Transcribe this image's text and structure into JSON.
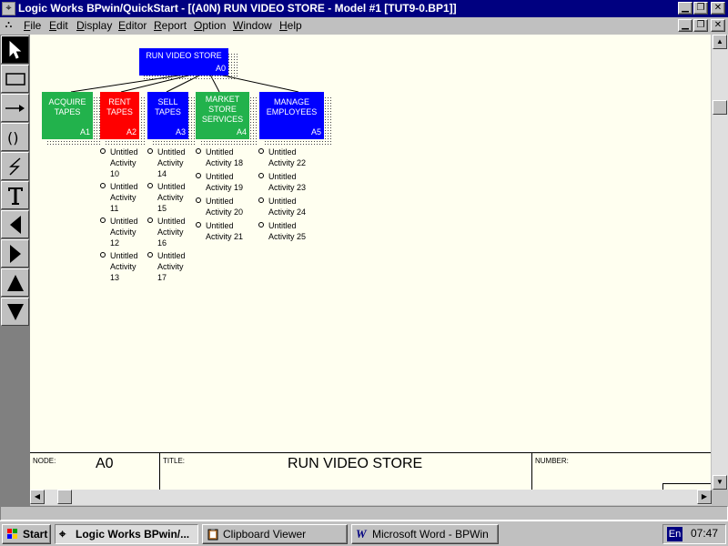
{
  "window": {
    "title": "Logic Works BPwin/QuickStart - [(A0N) RUN VIDEO STORE - Model #1  [TUT9-0.BP1]]",
    "app_icon": "bpwin-icon",
    "controls": [
      "minimize",
      "restore",
      "close"
    ]
  },
  "menu": {
    "items": [
      {
        "label": "File"
      },
      {
        "label": "Edit"
      },
      {
        "label": "Display"
      },
      {
        "label": "Editor"
      },
      {
        "label": "Report"
      },
      {
        "label": "Option"
      },
      {
        "label": "Window"
      },
      {
        "label": "Help"
      }
    ]
  },
  "toolbox": {
    "tools": [
      "pointer-tool",
      "box-tool",
      "arrow-tool",
      "tunnel-tool",
      "squiggle-tool",
      "text-tool",
      "go-left-tool",
      "go-right-tool",
      "go-up-tool",
      "go-down-tool"
    ]
  },
  "diagram": {
    "root": {
      "label": "RUN VIDEO STORE",
      "node": "A0",
      "color": "#0000ff"
    },
    "children": [
      {
        "label_line1": "ACQUIRE",
        "label_line2": "TAPES",
        "label_line3": "",
        "node": "A1",
        "color": "#22b24c"
      },
      {
        "label_line1": "RENT",
        "label_line2": "TAPES",
        "label_line3": "",
        "node": "A2",
        "color": "#ff0000"
      },
      {
        "label_line1": "SELL",
        "label_line2": "TAPES",
        "label_line3": "",
        "node": "A3",
        "color": "#0000ff"
      },
      {
        "label_line1": "MARKET",
        "label_line2": "STORE",
        "label_line3": "SERVICES",
        "node": "A4",
        "color": "#22b24c"
      },
      {
        "label_line1": "MANAGE",
        "label_line2": "EMPLOYEES",
        "label_line3": "",
        "node": "A5",
        "color": "#0000ff"
      }
    ],
    "activity_columns": [
      [
        {
          "line1": "Untitled",
          "line2": "Activity",
          "line3": "10"
        },
        {
          "line1": "Untitled",
          "line2": "Activity",
          "line3": "11"
        },
        {
          "line1": "Untitled",
          "line2": "Activity",
          "line3": "12"
        },
        {
          "line1": "Untitled",
          "line2": "Activity",
          "line3": "13"
        }
      ],
      [
        {
          "line1": "Untitled",
          "line2": "Activity",
          "line3": "14"
        },
        {
          "line1": "Untitled",
          "line2": "Activity",
          "line3": "15"
        },
        {
          "line1": "Untitled",
          "line2": "Activity",
          "line3": "16"
        },
        {
          "line1": "Untitled",
          "line2": "Activity",
          "line3": "17"
        }
      ],
      [
        {
          "line1": "Untitled",
          "line2": "Activity 18"
        },
        {
          "line1": "Untitled",
          "line2": "Activity 19"
        },
        {
          "line1": "Untitled",
          "line2": "Activity 20"
        },
        {
          "line1": "Untitled",
          "line2": "Activity 21"
        }
      ],
      [
        {
          "line1": "Untitled",
          "line2": "Activity 22"
        },
        {
          "line1": "Untitled",
          "line2": "Activity 23"
        },
        {
          "line1": "Untitled",
          "line2": "Activity 24"
        },
        {
          "line1": "Untitled",
          "line2": "Activity 25"
        }
      ]
    ]
  },
  "footer": {
    "node_label": "NODE:",
    "node_value": "A0",
    "title_label": "TITLE:",
    "title_value": "RUN VIDEO STORE",
    "number_label": "NUMBER:"
  },
  "taskbar": {
    "start_label": "Start",
    "tasks": [
      {
        "label": "Logic Works BPwin/...",
        "icon": "bpwin-icon",
        "active": true
      },
      {
        "label": "Clipboard Viewer",
        "icon": "clipboard-icon",
        "active": false
      },
      {
        "label": "Microsoft Word - BPWin",
        "icon": "word-icon",
        "active": false
      }
    ],
    "language": "En",
    "clock": "07:47"
  }
}
